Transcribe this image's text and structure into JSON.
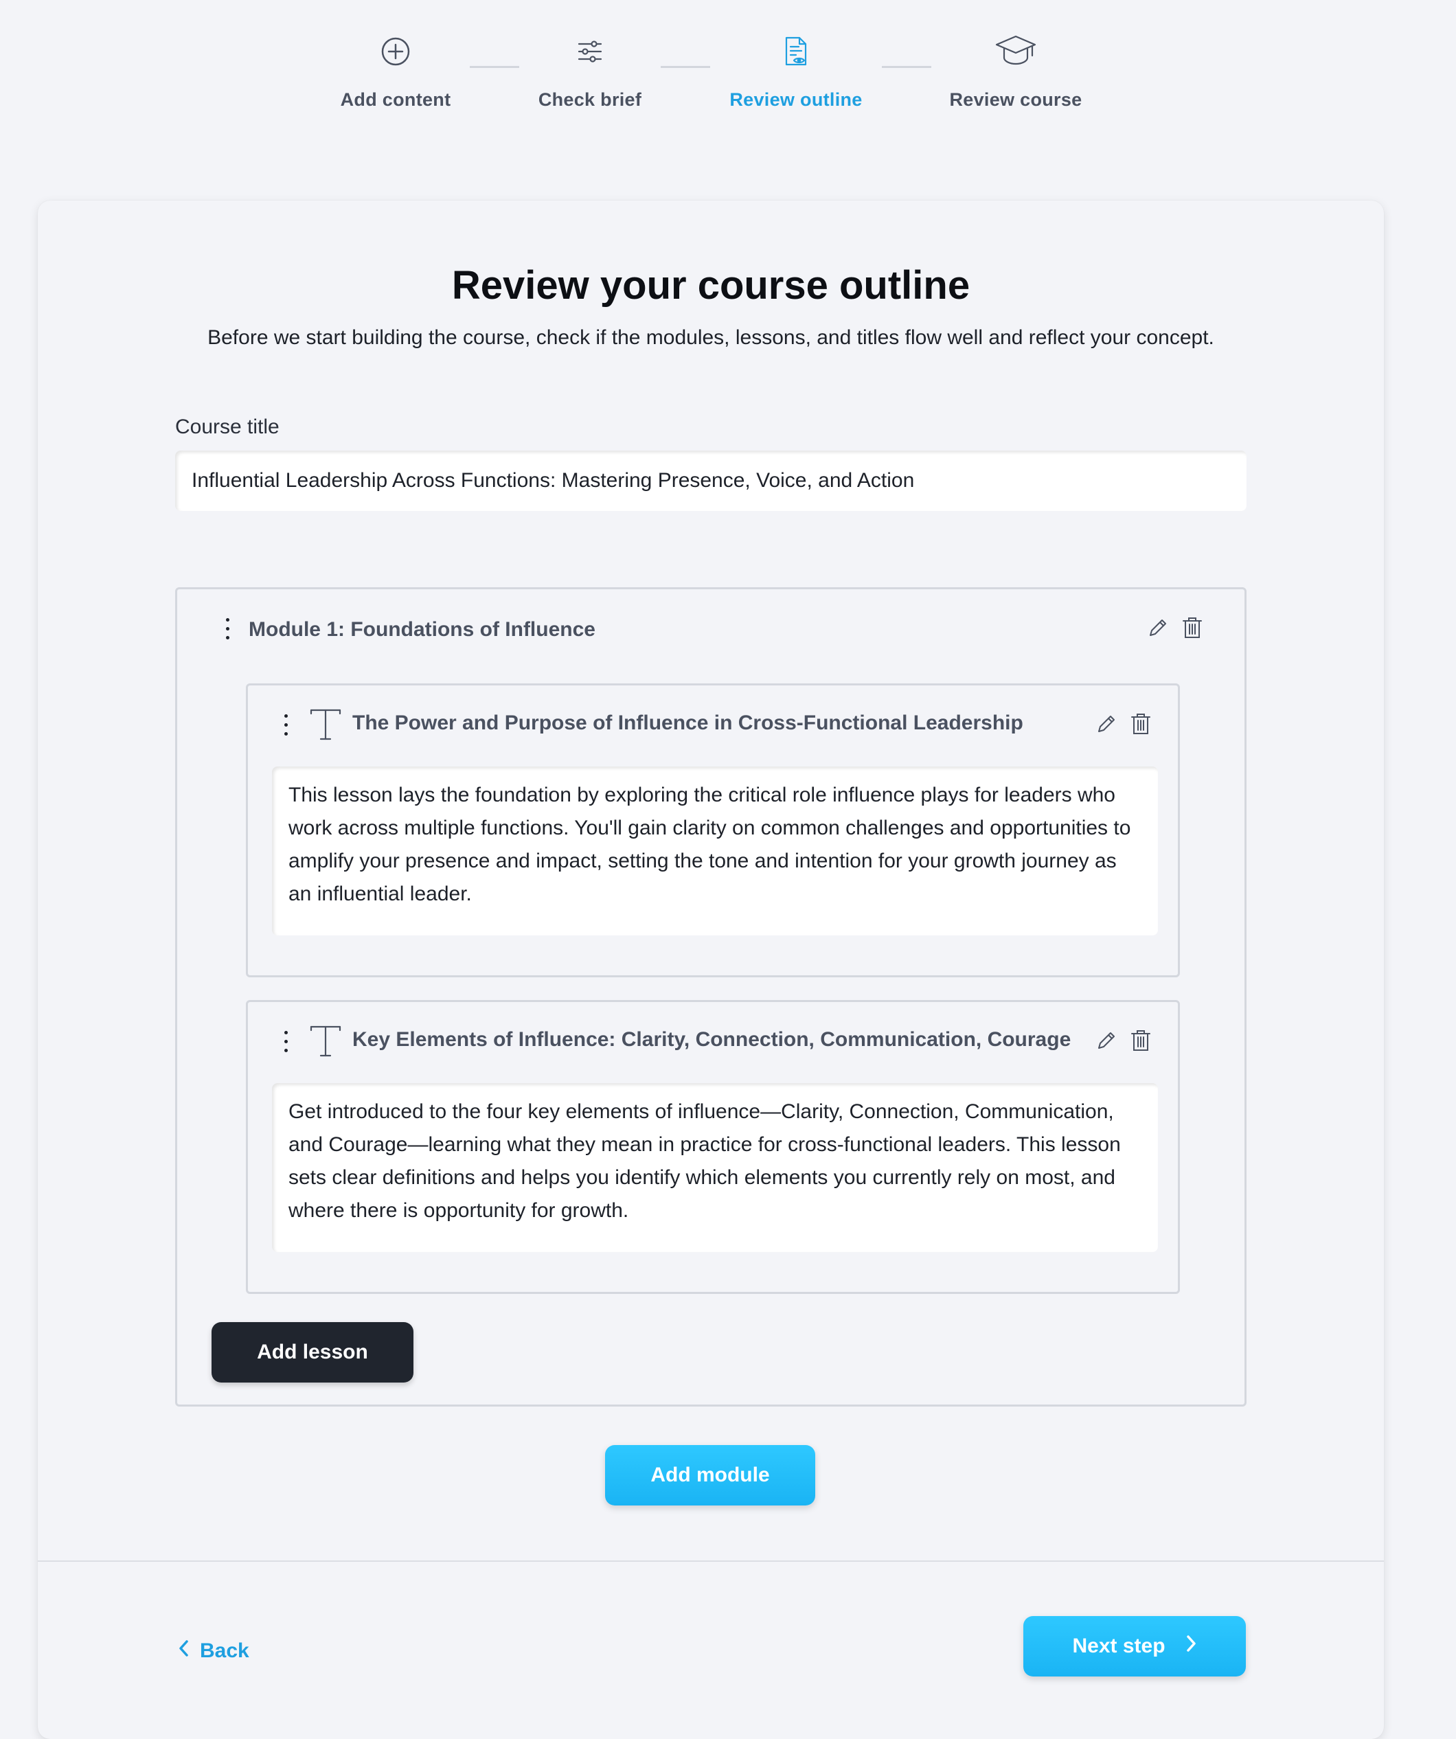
{
  "stepper": {
    "steps": [
      {
        "label": "Add content",
        "icon": "plus-circle-icon",
        "state": "done"
      },
      {
        "label": "Check brief",
        "icon": "sliders-icon",
        "state": "done"
      },
      {
        "label": "Review outline",
        "icon": "document-eye-icon",
        "state": "active"
      },
      {
        "label": "Review course",
        "icon": "graduation-cap-icon",
        "state": "pending"
      }
    ],
    "active_color": "#1e9fe0"
  },
  "page": {
    "title": "Review your course outline",
    "subtitle": "Before we start building the course, check if the modules, lessons, and titles flow well and reflect your concept."
  },
  "course": {
    "title_label": "Course title",
    "title_value": "Influential Leadership Across Functions: Mastering Presence, Voice, and Action"
  },
  "modules": [
    {
      "title": "Module 1: Foundations of Influence",
      "lessons": [
        {
          "title": "The Power and Purpose of Influence in Cross-Functional Leadership",
          "description": "This lesson lays the foundation by exploring the critical role influence plays for leaders who work across multiple functions. You'll gain clarity on common challenges and opportunities to amplify your presence and impact, setting the tone and intention for your growth journey as an influential leader."
        },
        {
          "title": "Key Elements of Influence: Clarity, Connection, Communication, Courage",
          "description": "Get introduced to the four key elements of influence—Clarity, Connection, Communication, and Courage—learning what they mean in practice for cross-functional leaders. This lesson sets clear definitions and helps you identify which elements you currently rely on most, and where there is opportunity for growth."
        }
      ],
      "add_lesson_label": "Add lesson"
    }
  ],
  "actions": {
    "add_module_label": "Add module",
    "back_label": "Back",
    "next_label": "Next step"
  },
  "colors": {
    "accent": "#1e9fe0",
    "button_blue": "#22bdf8",
    "button_dark": "#20252e",
    "background": "#f3f4f8"
  }
}
